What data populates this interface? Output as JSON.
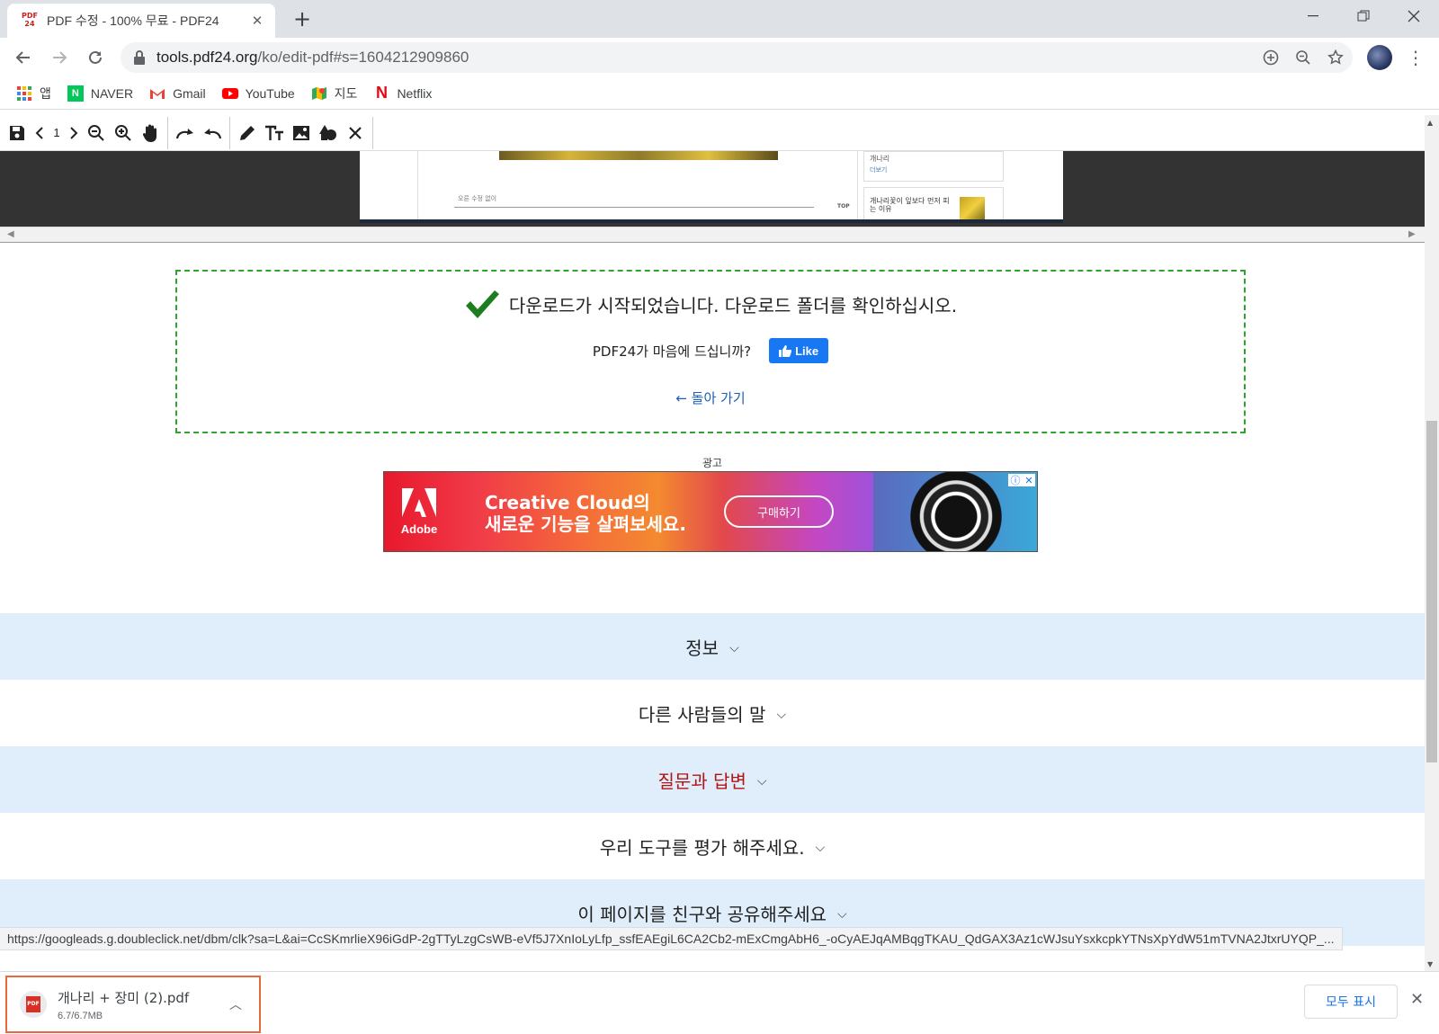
{
  "browser": {
    "tab_title": "PDF 수정 - 100% 무료 - PDF24",
    "tab_favicon": "PDF24",
    "url_host": "tools.pdf24.org",
    "url_path": "/ko/edit-pdf#s=1604212909860",
    "bookmarks": [
      {
        "label": "앱",
        "icon": "apps-grid-icon"
      },
      {
        "label": "NAVER",
        "icon": "naver-icon"
      },
      {
        "label": "Gmail",
        "icon": "gmail-icon"
      },
      {
        "label": "YouTube",
        "icon": "youtube-icon"
      },
      {
        "label": "지도",
        "icon": "maps-icon"
      },
      {
        "label": "Netflix",
        "icon": "netflix-icon"
      }
    ]
  },
  "editor": {
    "page_number": "1",
    "doc_snippet_1": "개나리",
    "doc_snippet_2": "개나리꽃이 잎보다 먼저 피는 이유",
    "doc_small": "더보기",
    "doc_bottom_text": "오른 수정 없이",
    "doc_top_label": "TOP"
  },
  "download_notice": {
    "message": "다운로드가 시작되었습니다. 다운로드 폴더를 확인하십시오.",
    "like_question": "PDF24가 마음에 드십니까?",
    "like_button": "Like",
    "back_link": "← 돌아 가기"
  },
  "ad": {
    "label": "광고",
    "brand": "Adobe",
    "headline_1": "Creative Cloud의",
    "headline_2": "새로운 기능을 살펴보세요.",
    "cta": "구매하기"
  },
  "sections": [
    {
      "label": "정보"
    },
    {
      "label": "다른 사람들의 말"
    },
    {
      "label": "질문과 답변"
    },
    {
      "label": "우리 도구를 평가 해주세요."
    },
    {
      "label": "이 페이지를 친구와 공유해주세요"
    }
  ],
  "status_url": "https://googleads.g.doubleclick.net/dbm/clk?sa=L&ai=CcSKmrlieX96iGdP-2gTTyLzgCsWB-eVf5J7XnIoLyLfp_ssfEAEgiL6CA2Cb2-mExCmgAbH6_-oCyAEJqAMBqgTKAU_QdGAX3Az1cWJsuYsxkcpkYTNsXpYdW51mTVNA2JtxrUYQP_...",
  "download_shelf": {
    "file_name": "개나리 + 장미 (2).pdf",
    "progress": "6.7/6.7MB",
    "show_all": "모두 표시"
  },
  "colors": {
    "accent": "#1a73e8",
    "success": "#2ea42e",
    "section_alt_bg": "#dfeefa",
    "highlight_text": "#b31414"
  }
}
